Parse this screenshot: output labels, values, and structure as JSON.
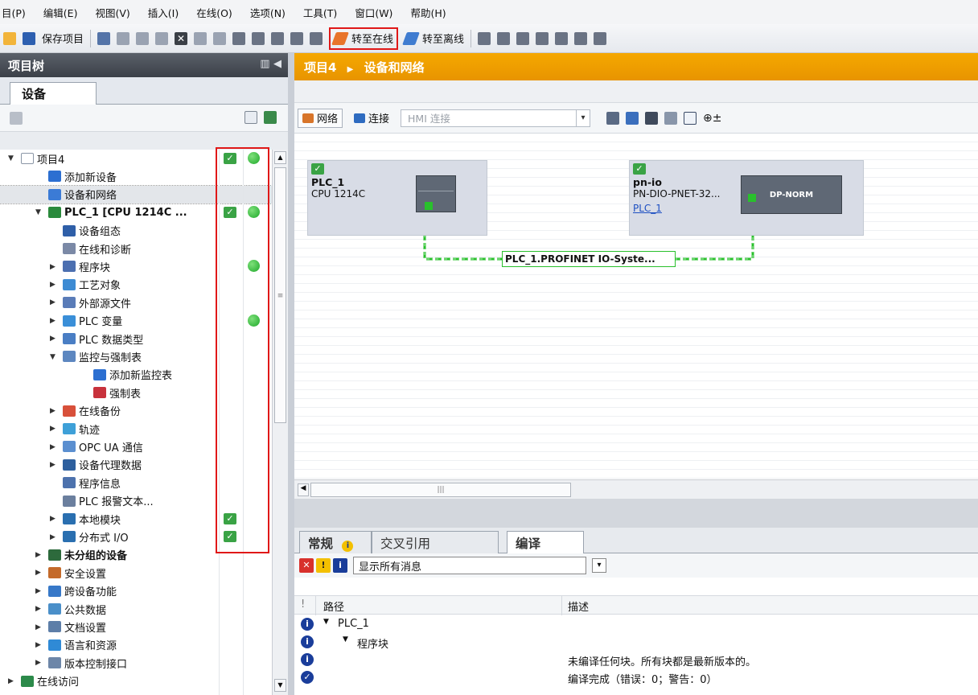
{
  "menu": [
    "目(P)",
    "编辑(E)",
    "视图(V)",
    "插入(I)",
    "在线(O)",
    "选项(N)",
    "工具(T)",
    "窗口(W)",
    "帮助(H)"
  ],
  "toolbar": {
    "save": "保存项目",
    "go_online": "转至在线",
    "go_offline": "转至离线"
  },
  "left_panel": {
    "title": "项目树",
    "tab": "设备",
    "tree": [
      {
        "label": "项目4",
        "level": 0,
        "arrow": "▼",
        "check": true,
        "dot": true,
        "color": "#ffffff"
      },
      {
        "label": "添加新设备",
        "level": 1,
        "arrow": "",
        "color": "#2c6fd1"
      },
      {
        "label": "设备和网络",
        "level": 1,
        "arrow": "",
        "color": "#3b7bd6",
        "selected": true
      },
      {
        "label": "PLC_1 [CPU 1214C ...",
        "level": 1,
        "arrow": "▼",
        "check": true,
        "dot": true,
        "color": "#2a8a3c",
        "bold": true
      },
      {
        "label": "设备组态",
        "level": 2,
        "arrow": "",
        "color": "#2f5fa8"
      },
      {
        "label": "在线和诊断",
        "level": 2,
        "arrow": "",
        "color": "#7b89a6"
      },
      {
        "label": "程序块",
        "level": 2,
        "arrow": "▶",
        "dot": true,
        "color": "#4c6fb0"
      },
      {
        "label": "工艺对象",
        "level": 2,
        "arrow": "▶",
        "color": "#3d8bd3"
      },
      {
        "label": "外部源文件",
        "level": 2,
        "arrow": "▶",
        "color": "#5a7cb8"
      },
      {
        "label": "PLC 变量",
        "level": 2,
        "arrow": "▶",
        "dot": true,
        "color": "#3a8fd8"
      },
      {
        "label": "PLC 数据类型",
        "level": 2,
        "arrow": "▶",
        "color": "#4a7ec4"
      },
      {
        "label": "监控与强制表",
        "level": 2,
        "arrow": "▼",
        "color": "#5d87c0"
      },
      {
        "label": "添加新监控表",
        "level": 3,
        "arrow": "",
        "color": "#2c6fd1"
      },
      {
        "label": "强制表",
        "level": 3,
        "arrow": "",
        "color": "#c8323c"
      },
      {
        "label": "在线备份",
        "level": 2,
        "arrow": "▶",
        "color": "#d8503a"
      },
      {
        "label": "轨迹",
        "level": 2,
        "arrow": "▶",
        "color": "#3ea0d8"
      },
      {
        "label": "OPC UA 通信",
        "level": 2,
        "arrow": "▶",
        "color": "#5b8fd0"
      },
      {
        "label": "设备代理数据",
        "level": 2,
        "arrow": "▶",
        "color": "#2d5f9e"
      },
      {
        "label": "程序信息",
        "level": 2,
        "arrow": "",
        "color": "#4d72ad"
      },
      {
        "label": "PLC 报警文本...",
        "level": 2,
        "arrow": "",
        "color": "#6b7f9e"
      },
      {
        "label": "本地模块",
        "level": 2,
        "arrow": "▶",
        "check": true,
        "color": "#2a6fb0"
      },
      {
        "label": "分布式 I/O",
        "level": 2,
        "arrow": "▶",
        "check": true,
        "color": "#2a6fb0"
      },
      {
        "label": "未分组的设备",
        "level": 1,
        "arrow": "▶",
        "color": "#2d6a3c",
        "bold": true
      },
      {
        "label": "安全设置",
        "level": 1,
        "arrow": "▶",
        "color": "#c46a2a"
      },
      {
        "label": "跨设备功能",
        "level": 1,
        "arrow": "▶",
        "color": "#3778c8"
      },
      {
        "label": "公共数据",
        "level": 1,
        "arrow": "▶",
        "color": "#4a8fc9"
      },
      {
        "label": "文档设置",
        "level": 1,
        "arrow": "▶",
        "color": "#5d7ea8"
      },
      {
        "label": "语言和资源",
        "level": 1,
        "arrow": "▶",
        "color": "#2f8ad6"
      },
      {
        "label": "版本控制接口",
        "level": 1,
        "arrow": "▶",
        "color": "#6d86a8"
      },
      {
        "label": "在线访问",
        "level": 0,
        "arrow": "▶",
        "color": "#2c8a4a"
      }
    ]
  },
  "right_panel": {
    "breadcrumb_project": "项目4",
    "breadcrumb_sep": "▶",
    "breadcrumb_page": "设备和网络",
    "tb_network": "网络",
    "tb_connect": "连接",
    "hmi_placeholder": "HMI 连接",
    "devices": {
      "plc": {
        "name": "PLC_1",
        "type": "CPU 1214C"
      },
      "io": {
        "name": "pn-io",
        "type": "PN-DIO-PNET-32...",
        "link": "PLC_1",
        "module": "DP-NORM"
      }
    },
    "network_label": "PLC_1.PROFINET IO-Syste..."
  },
  "inspector": {
    "tabs": [
      "常规",
      "交叉引用",
      "编译"
    ],
    "filter": "显示所有消息",
    "col_path": "路径",
    "col_desc": "描述",
    "rows": [
      {
        "path": "PLC_1",
        "arrow": "▼",
        "indent": 0,
        "desc": ""
      },
      {
        "path": "程序块",
        "arrow": "▼",
        "indent": 1,
        "desc": ""
      },
      {
        "path": "",
        "arrow": "",
        "indent": 0,
        "desc": "未编译任何块。所有块都是最新版本的。"
      },
      {
        "path": "",
        "arrow": "",
        "indent": 0,
        "desc": "编译完成（错误：0；警告：0）"
      }
    ]
  }
}
